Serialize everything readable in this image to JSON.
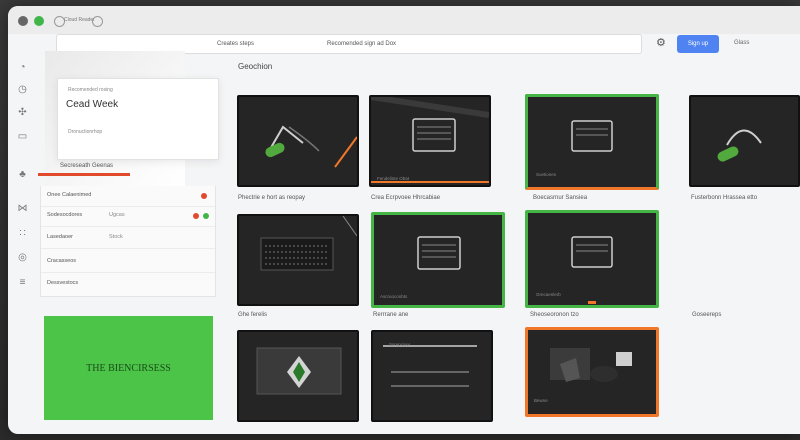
{
  "titlebar": {
    "text": "Cloud Reader"
  },
  "topbar": {
    "nav_a": "Creates steps",
    "nav_b": "Recomended sign ad Dox",
    "button_label": "Sign up",
    "right_text": "Glass"
  },
  "dropdown": {
    "small_top": "Recomended rosing",
    "title": "Cead Week",
    "small_bottom": "Dronuctionrhop"
  },
  "sidebar_label": "Secreseath Geenas",
  "list": [
    {
      "label": "Onee Calaenimed",
      "value": "",
      "dot": "#e14a2b"
    },
    {
      "label": "Sodesocdores",
      "value": "Ugcas",
      "dot": "#3fb54a"
    },
    {
      "label": "Lasedaoer",
      "value": "Stock",
      "dot": ""
    },
    {
      "label": "Cracasseos",
      "value": "",
      "dot": ""
    },
    {
      "label": "Dessvestocs",
      "value": "",
      "dot": ""
    }
  ],
  "promo": {
    "text": "THE BIENCIRSESS"
  },
  "section": {
    "title": "Geochion"
  },
  "cards": [
    {
      "caption": "Phectrie e hort as reopay",
      "inner": ""
    },
    {
      "caption": "Crea Ecrpvoee Hhrcabiae",
      "inner": "Fendelinte Obat"
    },
    {
      "caption": "Boecasrnur Sansiea",
      "inner": "Suetiones"
    },
    {
      "caption": "Fusterbonn Hrassea etto",
      "inner": ""
    },
    {
      "caption": "Ghe ferelis",
      "inner": "Pcioetiu"
    },
    {
      "caption": "Rerrrane ane",
      "inner": "Ascruoconbts"
    },
    {
      "caption": "Sheoseoronon tzo",
      "inner": "Grecaenlerb"
    },
    {
      "caption": "Goseereps",
      "inner": ""
    },
    {
      "caption": "",
      "inner": ""
    },
    {
      "caption": "",
      "inner": "Ssrepciser"
    },
    {
      "caption": "",
      "inner": "Bewne"
    }
  ],
  "colors": {
    "accent_green": "#45b646",
    "accent_orange": "#f0762a",
    "accent_blue": "#4e83f1",
    "accent_red": "#e14a2b"
  }
}
